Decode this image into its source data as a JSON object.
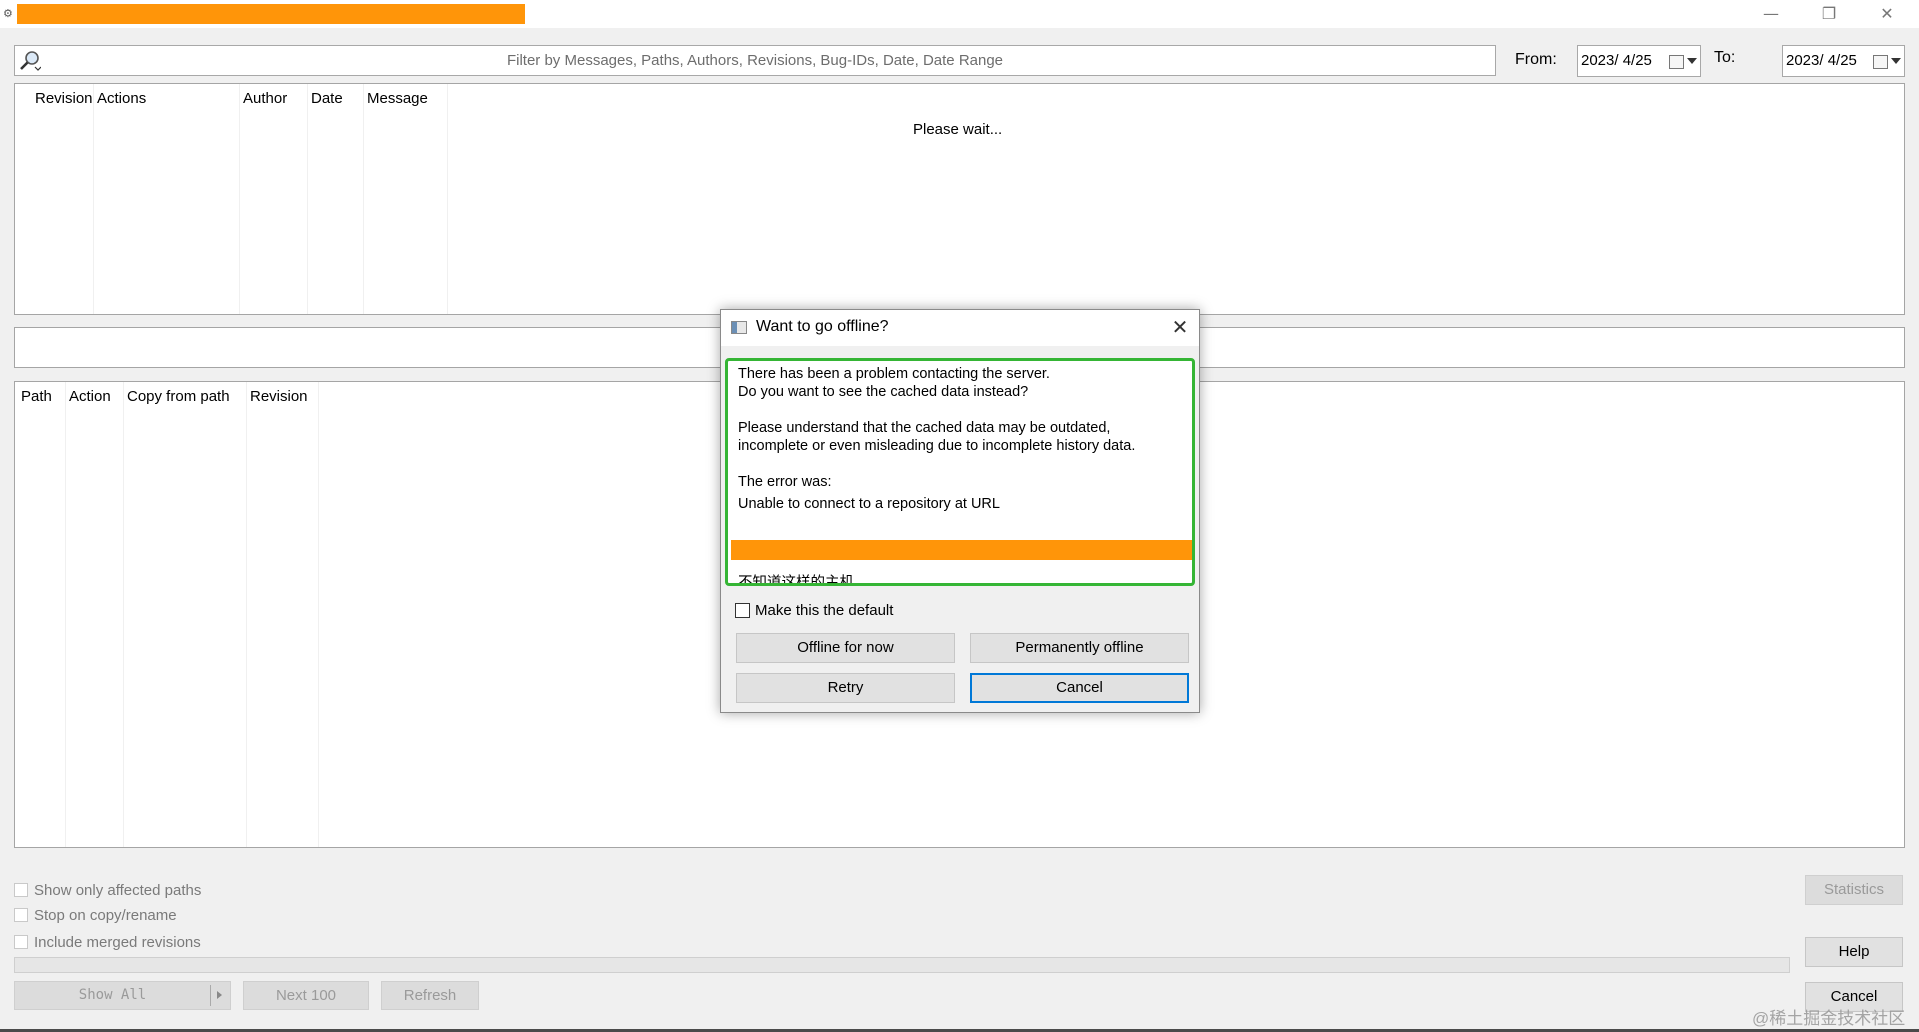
{
  "window": {
    "app_icon": "tortoisesvn-log-icon",
    "minimize_glyph": "—",
    "restore_glyph": "❐",
    "close_glyph": "✕"
  },
  "filter": {
    "icon": "magnifier-icon",
    "placeholder": "Filter by Messages, Paths, Authors, Revisions, Bug-IDs, Date, Date Range",
    "from_label": "From:",
    "from_value": "2023/  4/25",
    "to_label": "To:",
    "to_value": "2023/  4/25"
  },
  "revisions_table": {
    "columns": [
      "Revision",
      "Actions",
      "Author",
      "Date",
      "Message"
    ],
    "status": "Please wait..."
  },
  "paths_table": {
    "columns": [
      "Path",
      "Action",
      "Copy from path",
      "Revision"
    ]
  },
  "options": {
    "show_only_affected": "Show only affected paths",
    "stop_on_copy": "Stop on copy/rename",
    "include_merged": "Include merged revisions"
  },
  "buttons": {
    "show_all": "Show All",
    "next_100": "Next 100",
    "refresh": "Refresh",
    "statistics": "Statistics",
    "help": "Help",
    "cancel": "Cancel"
  },
  "dialog": {
    "title": "Want to go offline?",
    "close_glyph": "✕",
    "message_lines": [
      "There has been a problem contacting the server.",
      "Do you want to see the cached data instead?",
      "Please understand that the cached data may be outdated,",
      "incomplete or even misleading due to incomplete history data.",
      "The error was:",
      "Unable to connect to a repository at URL",
      "不知道这样的主机。"
    ],
    "make_default_label": "Make this the default",
    "offline_for_now": "Offline for now",
    "permanently_offline": "Permanently offline",
    "retry": "Retry",
    "cancel": "Cancel"
  },
  "watermark": "@稀土掘金技术社区"
}
